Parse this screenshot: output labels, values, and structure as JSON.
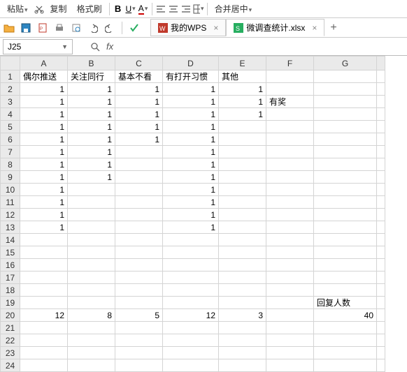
{
  "toolbar": {
    "paste_dd": "粘贴",
    "copy": "复制",
    "format_painter": "格式刷",
    "merge_center": "合并居中"
  },
  "tabs": {
    "wps_home": "我的WPS",
    "file_name": "微调查统计.xlsx"
  },
  "name_box": "J25",
  "columns": [
    "A",
    "B",
    "C",
    "D",
    "E",
    "F",
    "G"
  ],
  "row_count": 24,
  "headers": {
    "A1": "偶尔推送",
    "B1": "关注同行",
    "C1": "基本不看",
    "D1": "有打开习惯",
    "E1": "其他"
  },
  "cells": {
    "A2": "1",
    "B2": "1",
    "C2": "1",
    "D2": "1",
    "E2": "1",
    "A3": "1",
    "B3": "1",
    "C3": "1",
    "D3": "1",
    "E3": "1",
    "F3": "有奖",
    "A4": "1",
    "B4": "1",
    "C4": "1",
    "D4": "1",
    "E4": "1",
    "A5": "1",
    "B5": "1",
    "C5": "1",
    "D5": "1",
    "A6": "1",
    "B6": "1",
    "C6": "1",
    "D6": "1",
    "A7": "1",
    "B7": "1",
    "D7": "1",
    "A8": "1",
    "B8": "1",
    "D8": "1",
    "A9": "1",
    "B9": "1",
    "D9": "1",
    "A10": "1",
    "D10": "1",
    "A11": "1",
    "D11": "1",
    "A12": "1",
    "D12": "1",
    "A13": "1",
    "D13": "1",
    "G19": "回复人数",
    "A20": "12",
    "B20": "8",
    "C20": "5",
    "D20": "12",
    "E20": "3",
    "G20": "40"
  },
  "text_cells": [
    "A1",
    "B1",
    "C1",
    "D1",
    "E1",
    "F3",
    "G19"
  ]
}
